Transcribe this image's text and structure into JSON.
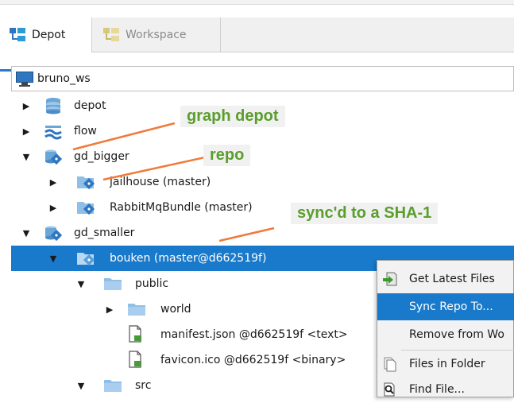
{
  "tabs": {
    "depot": "Depot",
    "workspace": "Workspace"
  },
  "workspace_selector": {
    "value": "bruno_ws"
  },
  "tree": [
    {
      "label": "depot",
      "expanded": false,
      "icon": "database-stack-icon"
    },
    {
      "label": "flow",
      "expanded": false,
      "icon": "stream-depot-icon"
    },
    {
      "label": "gd_bigger",
      "expanded": true,
      "icon": "graph-depot-icon"
    },
    {
      "label": "jailhouse (master)",
      "expanded": false,
      "icon": "repo-icon"
    },
    {
      "label": "RabbitMqBundle (master)",
      "expanded": false,
      "icon": "repo-icon"
    },
    {
      "label": "gd_smaller",
      "expanded": true,
      "icon": "graph-depot-icon"
    },
    {
      "label": "bouken (master@d662519f)",
      "expanded": true,
      "icon": "repo-icon",
      "selected": true
    },
    {
      "label": "public",
      "expanded": true,
      "icon": "folder-icon"
    },
    {
      "label": "world",
      "expanded": false,
      "icon": "folder-icon"
    },
    {
      "label": "manifest.json @d662519f <text>",
      "icon": "file-icon"
    },
    {
      "label": "favicon.ico @d662519f <binary>",
      "icon": "file-icon"
    },
    {
      "label": "src",
      "expanded": true,
      "icon": "folder-icon"
    }
  ],
  "annotations": {
    "graph_depot": "graph depot",
    "repo": "repo",
    "sync": "sync'd to a SHA-1"
  },
  "context_menu": [
    {
      "label": "Get Latest Files",
      "icon": "get-latest-icon"
    },
    {
      "label": "Sync Repo To...",
      "highlighted": true
    },
    {
      "label": "Remove from Wo"
    },
    {
      "label": "Files in Folder",
      "icon": "files-in-folder-icon"
    },
    {
      "label": "Find File...",
      "icon": "find-file-icon"
    }
  ],
  "colors": {
    "selection": "#1979ca",
    "annotation_text": "#5a9e2c",
    "annotation_arrow": "#f07a3a",
    "folder": "#8fbfe6"
  }
}
